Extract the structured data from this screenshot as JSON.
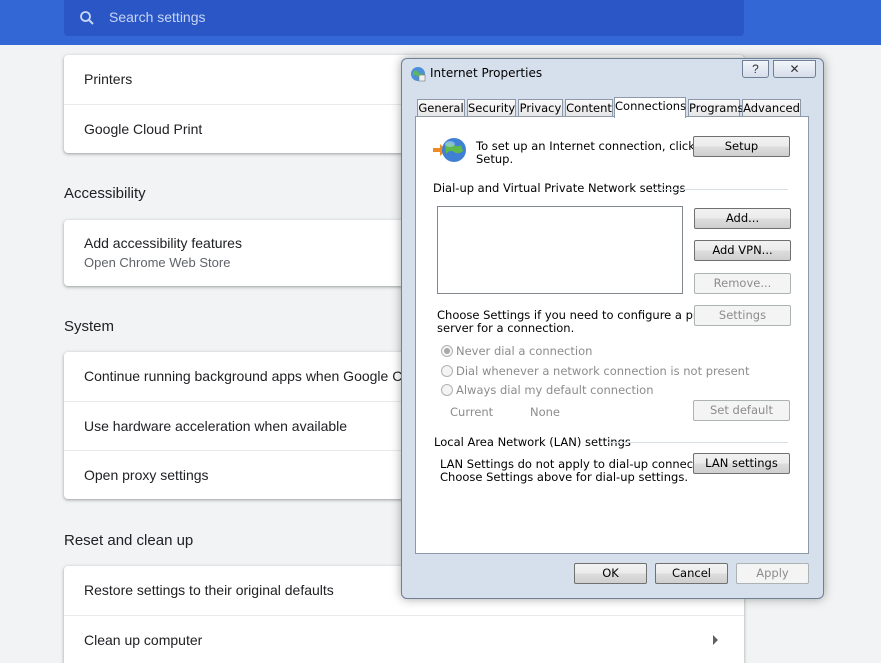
{
  "search": {
    "placeholder": "Search settings"
  },
  "printing": {
    "items": [
      "Printers",
      "Google Cloud Print"
    ]
  },
  "accessibility": {
    "title": "Accessibility",
    "item_label": "Add accessibility features",
    "item_sub": "Open Chrome Web Store"
  },
  "system": {
    "title": "System",
    "items": [
      "Continue running background apps when Google Chrome is closed",
      "Use hardware acceleration when available",
      "Open proxy settings"
    ]
  },
  "reset": {
    "title": "Reset and clean up",
    "items": [
      "Restore settings to their original defaults",
      "Clean up computer"
    ]
  },
  "dialog": {
    "title": "Internet Properties",
    "help": "?",
    "close": "✕",
    "tabs": [
      "General",
      "Security",
      "Privacy",
      "Content",
      "Connections",
      "Programs",
      "Advanced"
    ],
    "active_tab": "Connections",
    "setup_text_1": "To set up an Internet connection, click",
    "setup_text_2": "Setup.",
    "setup_button": "Setup",
    "dialup_group": "Dial-up and Virtual Private Network settings",
    "add_button": "Add...",
    "add_vpn_button": "Add VPN...",
    "remove_button": "Remove...",
    "proxy_text_1": "Choose Settings if you need to configure a proxy",
    "proxy_text_2": "server for a connection.",
    "settings_button": "Settings",
    "radio_never": "Never dial a connection",
    "radio_whenever": "Dial whenever a network connection is not present",
    "radio_always": "Always dial my default connection",
    "current_label": "Current",
    "current_value": "None",
    "set_default_button": "Set default",
    "lan_group": "Local Area Network (LAN) settings",
    "lan_text_1": "LAN Settings do not apply to dial-up connections.",
    "lan_text_2": "Choose Settings above for dial-up settings.",
    "lan_button": "LAN settings",
    "ok_button": "OK",
    "cancel_button": "Cancel",
    "apply_button": "Apply"
  },
  "colors": {
    "header": "#3367d6",
    "background": "#f1f3f4",
    "dialog_frame": "#d6dfec"
  }
}
